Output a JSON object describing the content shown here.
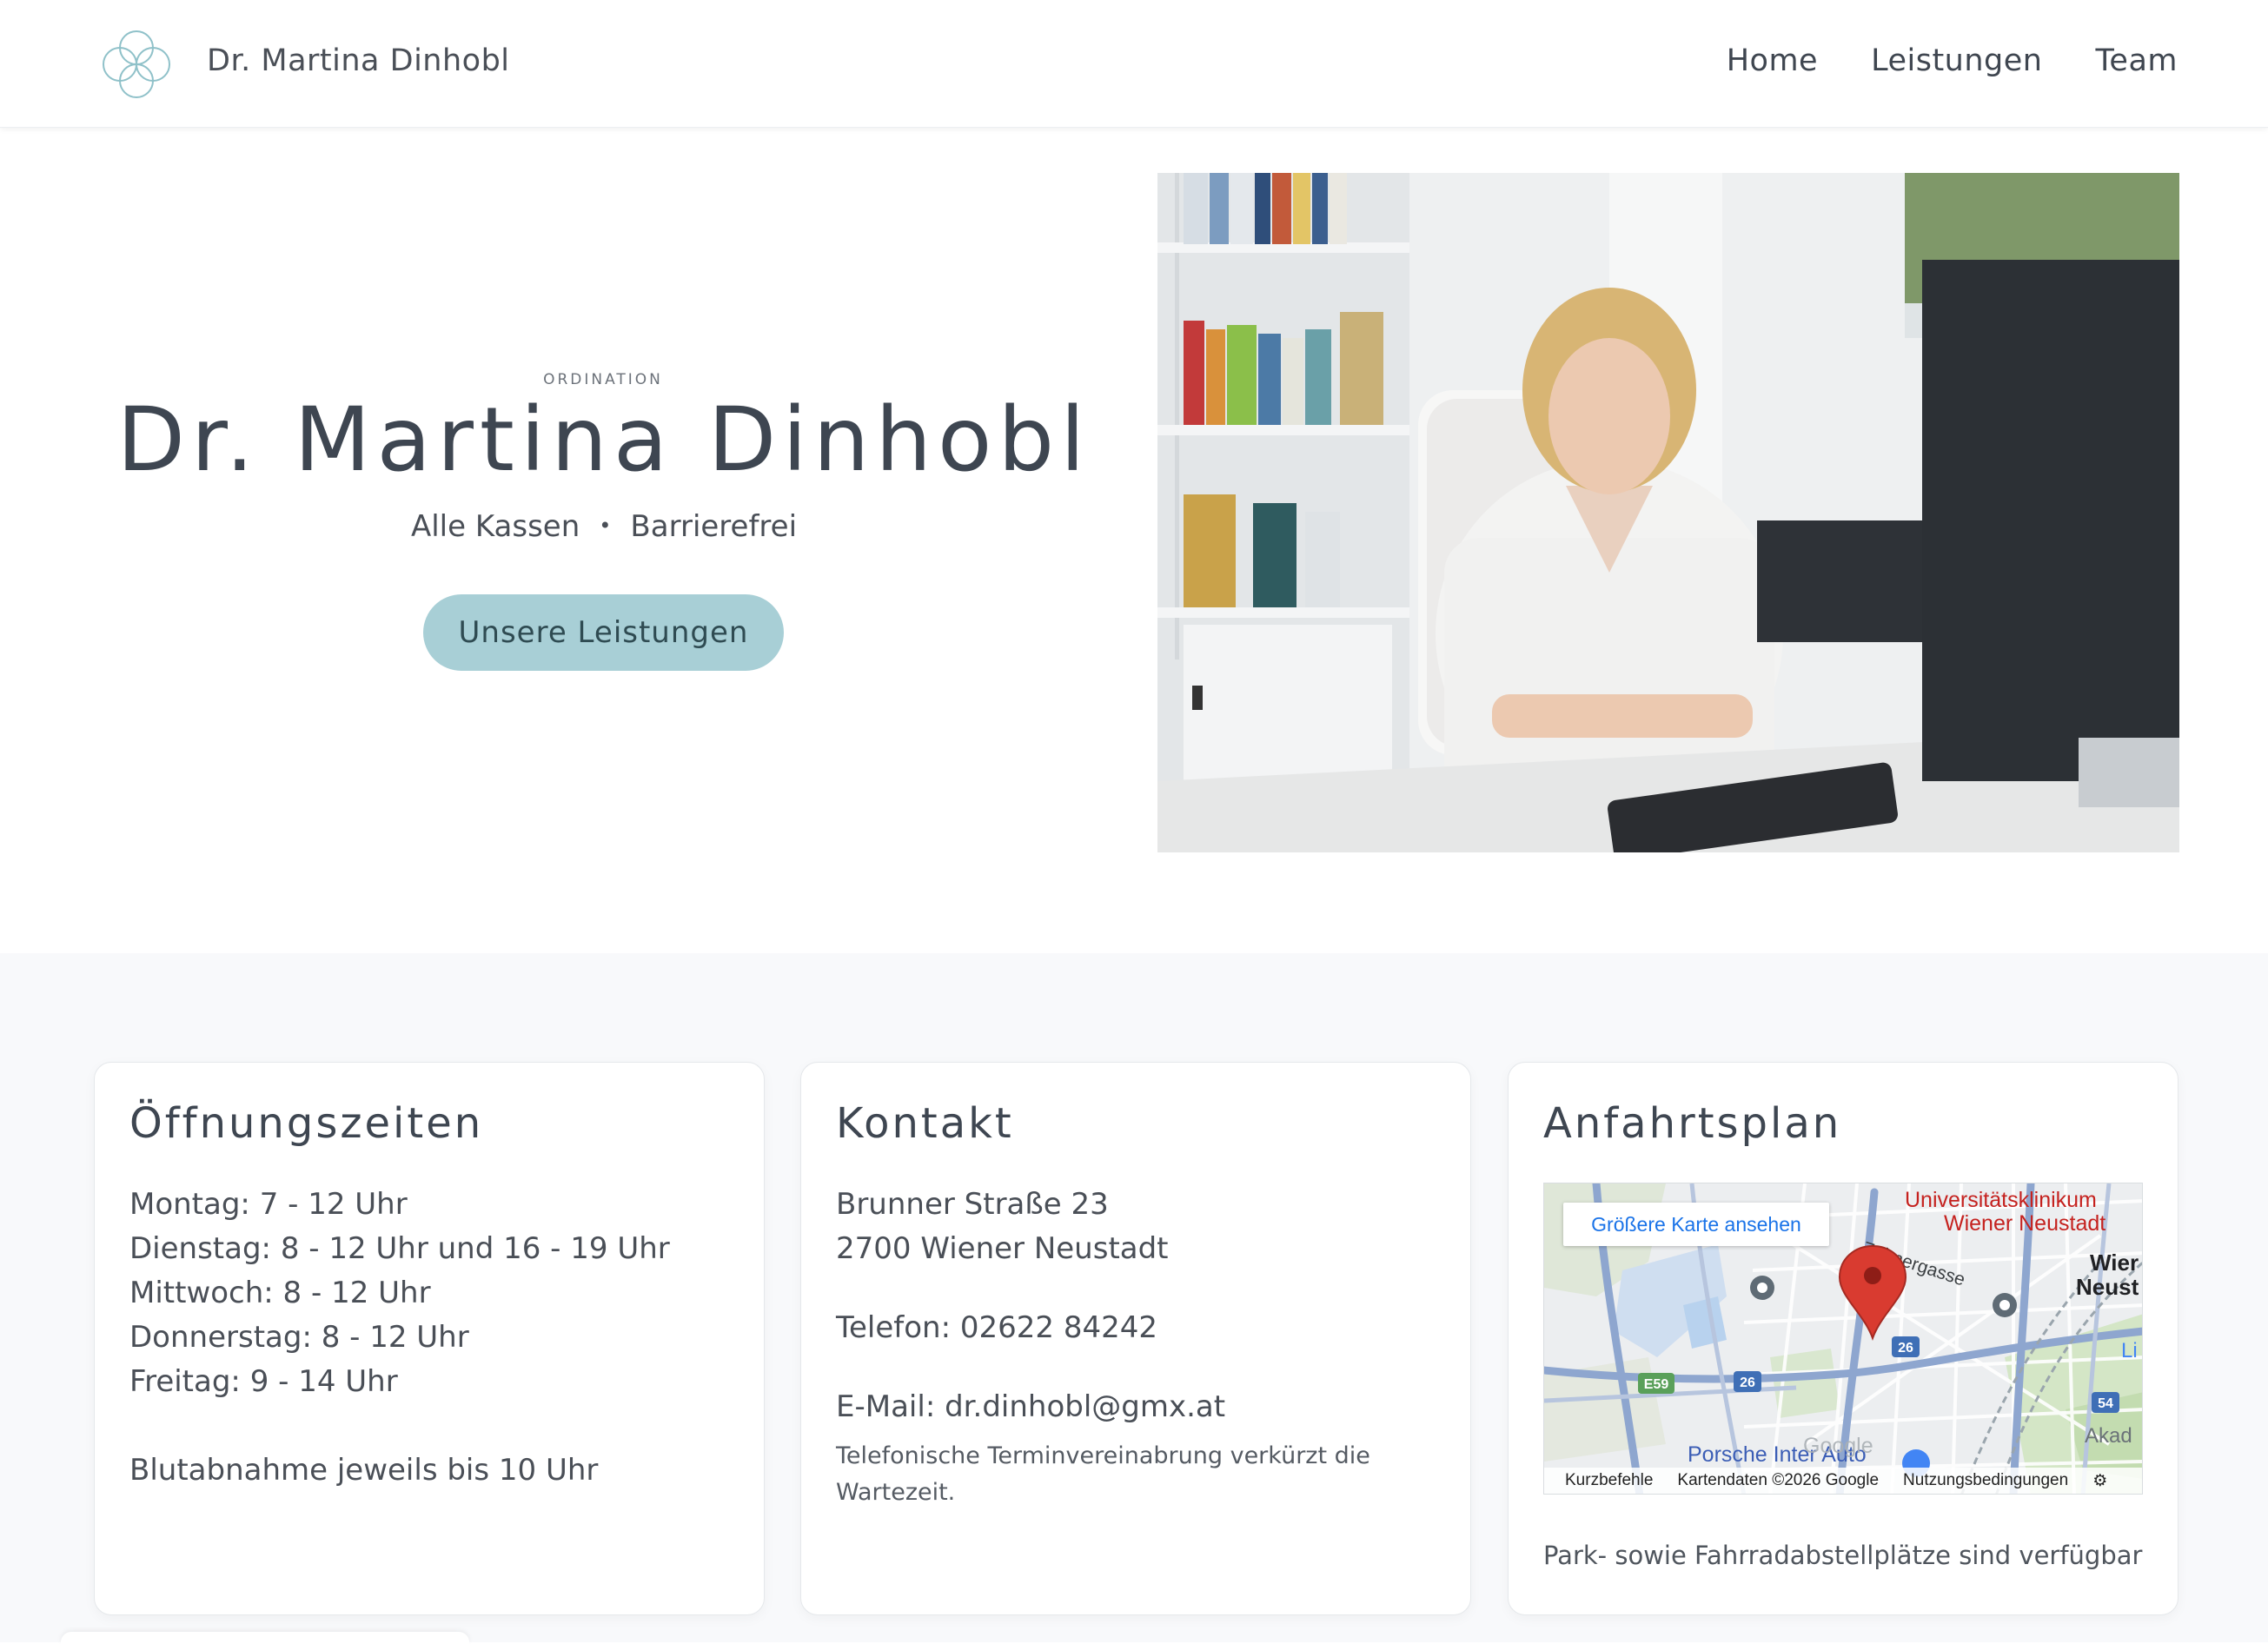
{
  "header": {
    "brand": "Dr. Martina Dinhobl",
    "logo_icon": "four-circle-flower-icon",
    "nav": [
      {
        "label": "Home"
      },
      {
        "label": "Leistungen"
      },
      {
        "label": "Team"
      }
    ]
  },
  "hero": {
    "eyebrow": "ORDINATION",
    "title": "Dr. Martina Dinhobl",
    "sub_left": "Alle Kassen",
    "sub_sep": "•",
    "sub_right": "Barrierefrei",
    "cta": "Unsere Leistungen",
    "photo": "doctor-at-desk-photo"
  },
  "opening": {
    "title": "Öffnungszeiten",
    "lines": [
      "Montag: 7 - 12 Uhr",
      "Dienstag: 8 - 12 Uhr und 16 - 19 Uhr",
      "Mittwoch: 8 - 12 Uhr",
      "Donnerstag: 8 - 12 Uhr",
      "Freitag: 9 - 14 Uhr"
    ],
    "note": "Blutabnahme jeweils bis 10 Uhr"
  },
  "contact": {
    "title": "Kontakt",
    "street": "Brunner Straße 23",
    "city": "2700 Wiener Neustadt",
    "phone": "Telefon: 02622 84242",
    "email": "E-Mail: dr.dinhobl@gmx.at",
    "note": "Telefonische Terminvereinabrung verkürzt die Wartezeit."
  },
  "directions": {
    "title": "Anfahrtsplan",
    "map": {
      "larger_map": "Größere Karte ansehen",
      "labels": {
        "uni1": "Universitätsklinikum",
        "uni2": "Wiener Neustadt",
        "street": "Zehnergasse",
        "city1": "Wier",
        "city2": "Neust",
        "li": "Li",
        "akad": "Akad",
        "porsche": "Porsche Inter Auto",
        "google": "Google",
        "r26a": "26",
        "r26b": "26",
        "e59": "E59",
        "r54": "54"
      },
      "footer": {
        "shortcuts": "Kurzbefehle",
        "data": "Kartendaten ©2026 Google",
        "terms": "Nutzungsbedingungen"
      }
    },
    "note": "Park- sowie Fahrradabstellplätze sind verfügbar"
  },
  "colors": {
    "accent": "#a8cfd6",
    "logo": "#8fc1c9",
    "text": "#3e4651",
    "map_pin": "#d93b30",
    "map_label": "#c5221f"
  }
}
